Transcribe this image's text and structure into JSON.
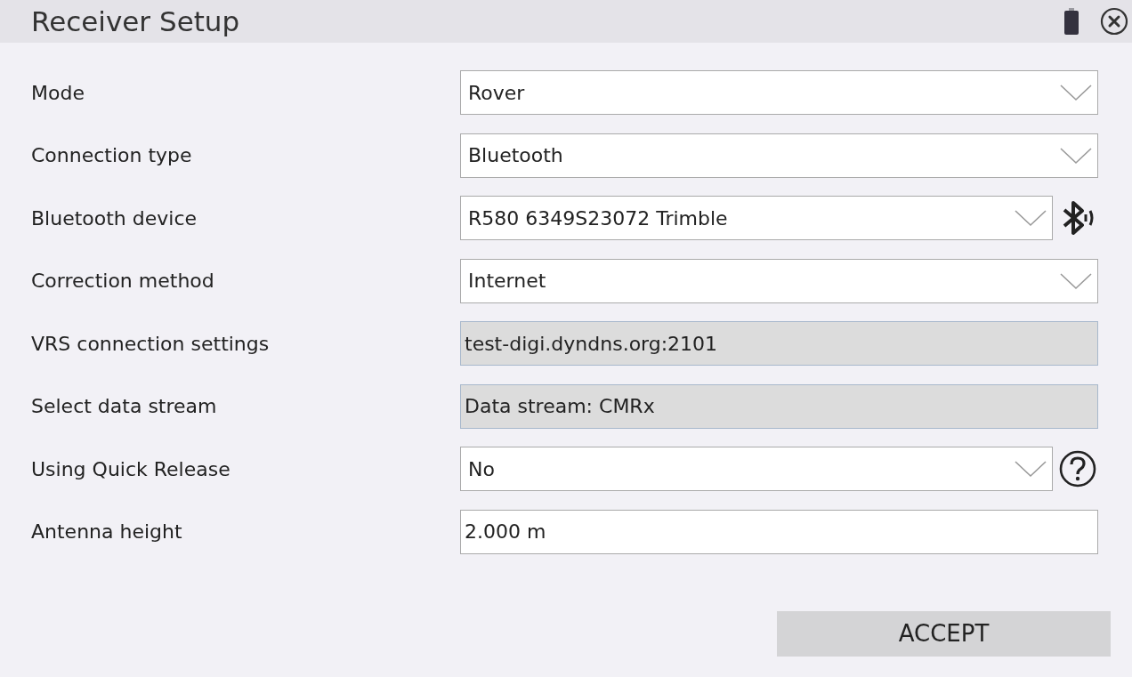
{
  "window": {
    "title": "Receiver Setup"
  },
  "fields": [
    {
      "label": "Mode",
      "kind": "dropdown",
      "value": "Rover"
    },
    {
      "label": "Connection type",
      "kind": "dropdown",
      "value": "Bluetooth"
    },
    {
      "label": "Bluetooth device",
      "kind": "dropdown",
      "value": "R580 6349S23072 Trimble",
      "accessory": {
        "kind": "bluetooth"
      }
    },
    {
      "label": "Correction method",
      "kind": "dropdown",
      "value": "Internet"
    },
    {
      "label": "VRS connection settings",
      "kind": "link",
      "value": "test-digi.dyndns.org:2101"
    },
    {
      "label": "Select data stream",
      "kind": "link",
      "value": "Data stream: CMRx"
    },
    {
      "label": "Using Quick Release",
      "kind": "dropdown",
      "value": "No",
      "accessory": {
        "kind": "help"
      }
    },
    {
      "label": "Antenna height",
      "kind": "input",
      "value": "2.000 m"
    }
  ],
  "buttons": [
    {
      "label": "ACCEPT"
    }
  ]
}
